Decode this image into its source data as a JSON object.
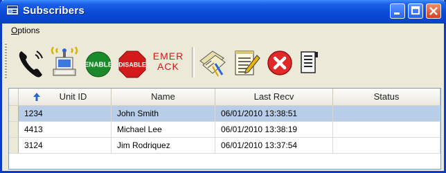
{
  "window": {
    "title": "Subscribers"
  },
  "menubar": {
    "items": [
      "Options"
    ]
  },
  "toolbar": {
    "buttons": [
      {
        "name": "phone",
        "icon": "telephone-handset-icon"
      },
      {
        "name": "wireless-terminal",
        "icon": "wireless-terminal-icon"
      },
      {
        "name": "enable",
        "label": "ENABLE",
        "color": "#1a8a2a"
      },
      {
        "name": "disable",
        "label": "DISABLE",
        "color": "#d21a1a"
      },
      {
        "name": "emergency-ack",
        "label_line1": "EMER",
        "label_line2": "ACK",
        "color": "#d01818"
      },
      {
        "name": "edit-tags",
        "icon": "tagged-folder-icon"
      },
      {
        "name": "edit-notes",
        "icon": "notepad-pencil-icon"
      },
      {
        "name": "delete",
        "icon": "red-x-circle-icon"
      },
      {
        "name": "details",
        "icon": "document-list-icon"
      }
    ]
  },
  "table": {
    "columns": [
      "Unit ID",
      "Name",
      "Last Recv",
      "Status"
    ],
    "sort_column": "Unit ID",
    "sort_direction": "ascending",
    "rows": [
      {
        "unit_id": "1234",
        "name": "John Smith",
        "last_recv": "06/01/2010  13:38:51",
        "status": "",
        "selected": true
      },
      {
        "unit_id": "4413",
        "name": "Michael Lee",
        "last_recv": "06/01/2010  13:38:19",
        "status": "",
        "selected": false
      },
      {
        "unit_id": "3124",
        "name": "Jim Rodriquez",
        "last_recv": "06/01/2010  13:37:54",
        "status": "",
        "selected": false
      }
    ]
  },
  "colors": {
    "titlebar": "#0a4ad6",
    "selection": "#b8cde8",
    "face": "#ece9d8"
  }
}
